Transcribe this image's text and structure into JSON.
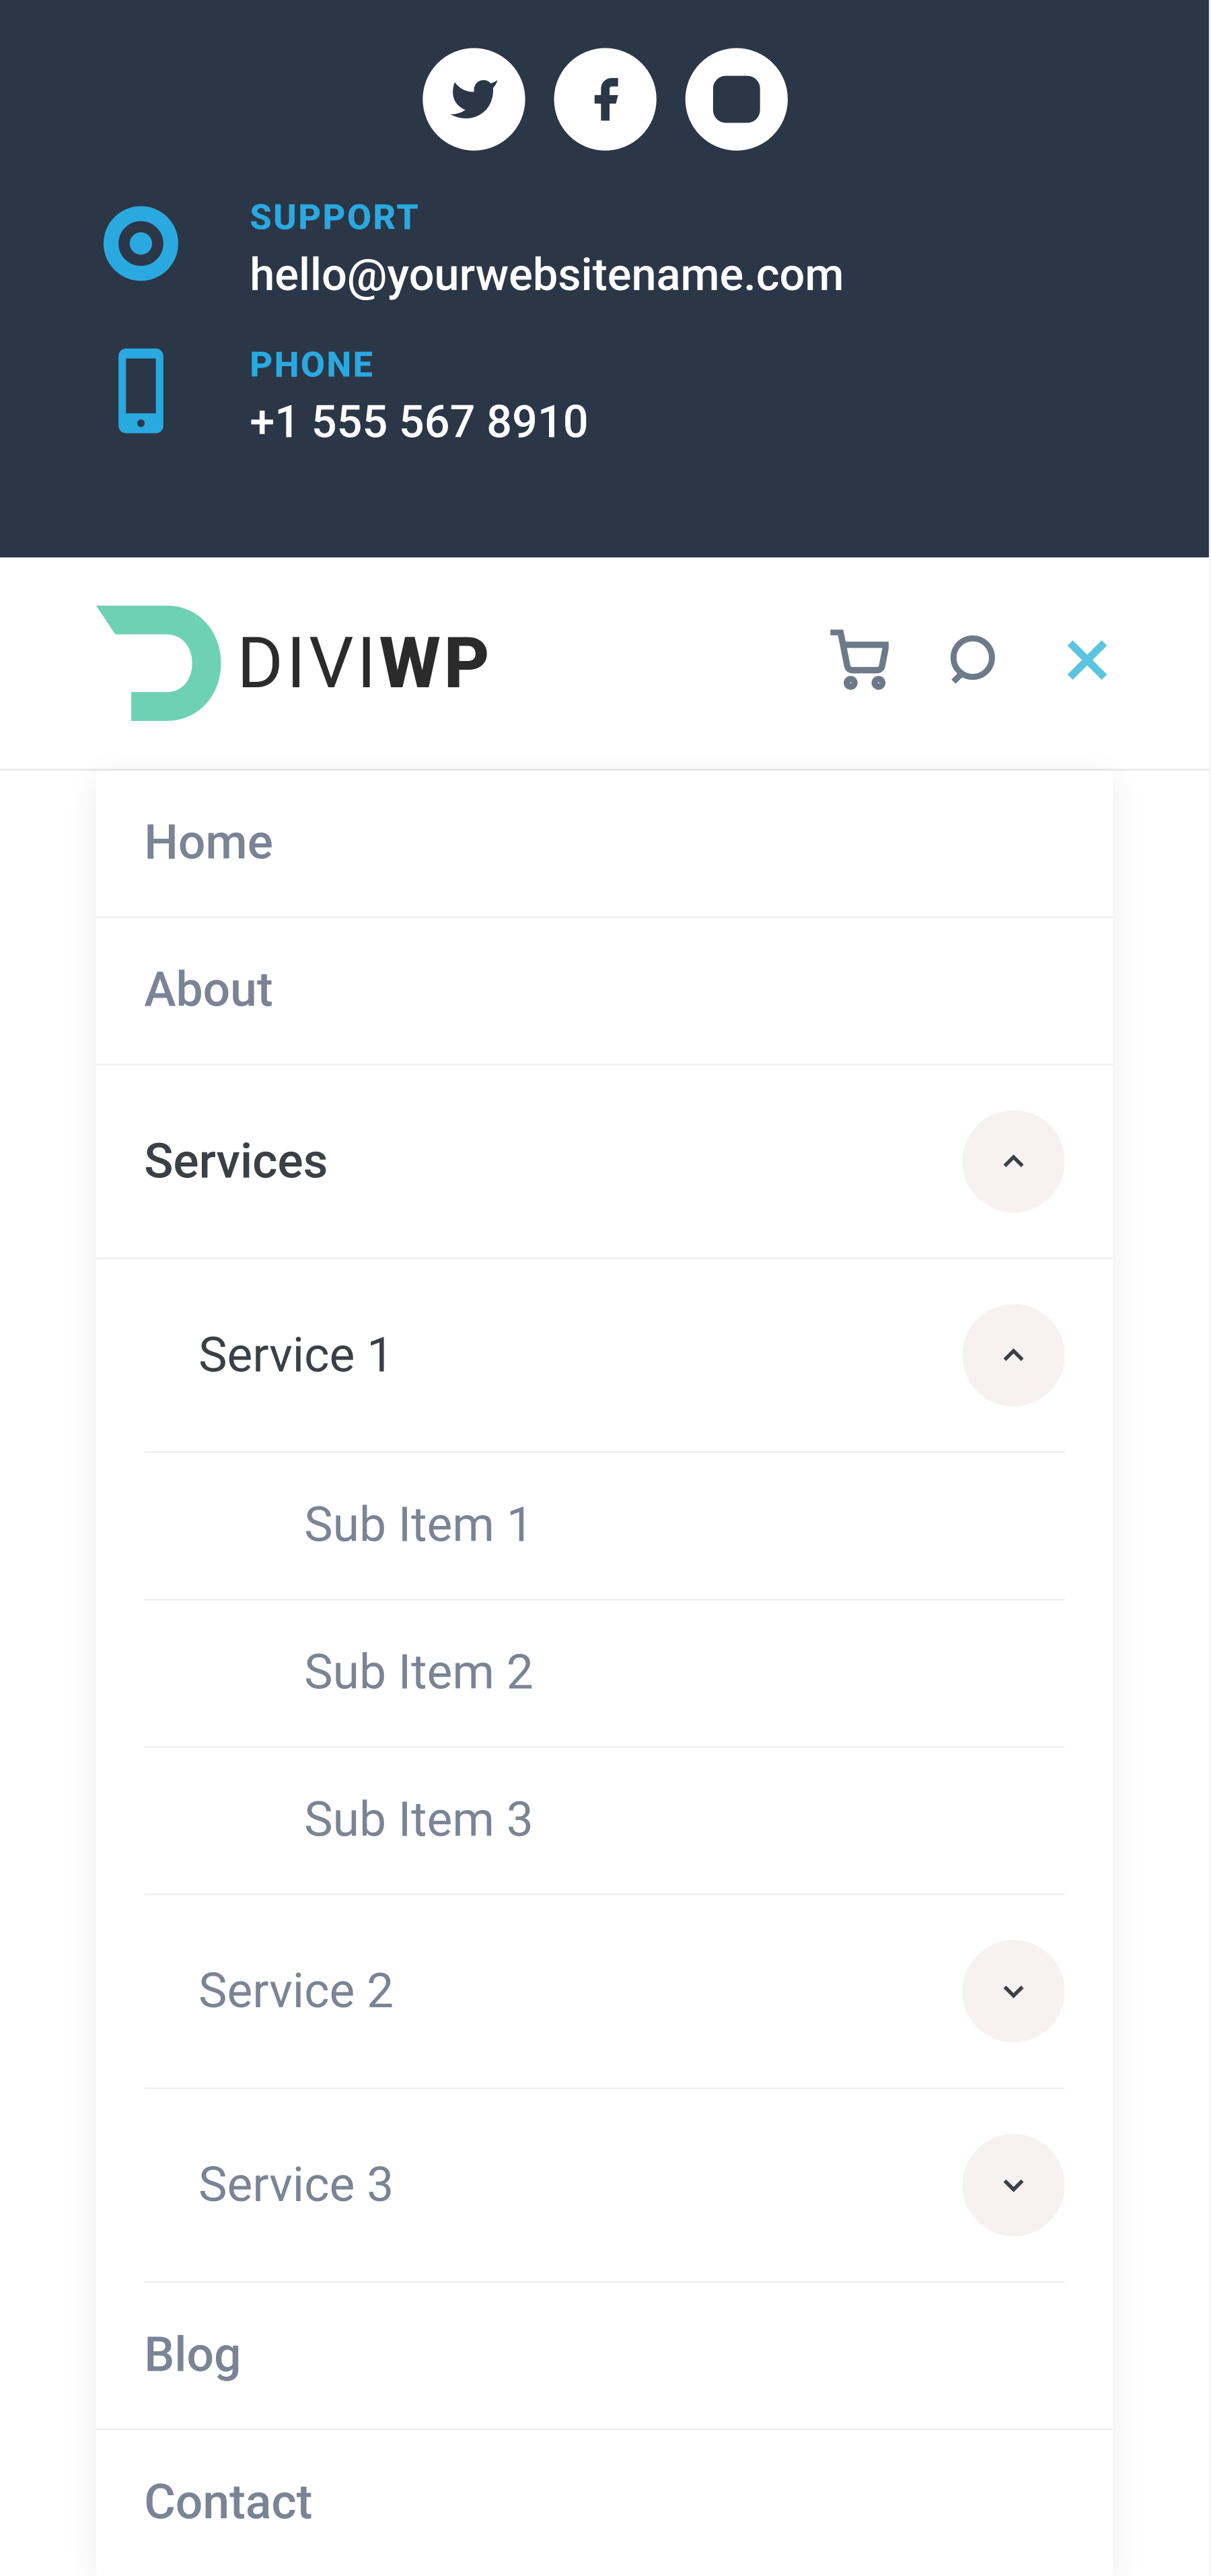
{
  "topbar": {
    "support": {
      "label": "SUPPORT",
      "value": "hello@yourwebsitename.com"
    },
    "phone": {
      "label": "PHONE",
      "value": "+1 555 567 8910"
    }
  },
  "logo": {
    "text1": "DIVI",
    "text2": "WP"
  },
  "menu": {
    "home": "Home",
    "about": "About",
    "services": "Services",
    "service1": "Service 1",
    "sub1": "Sub Item 1",
    "sub2": "Sub Item 2",
    "sub3": "Sub Item 3",
    "service2": "Service 2",
    "service3": "Service 3",
    "blog": "Blog",
    "contact": "Contact"
  },
  "colors": {
    "darkbg": "#2b3647",
    "accent_blue": "#2aa9e0",
    "mint": "#6fd1b3",
    "close_blue": "#5bc4de",
    "text_gray": "#7a8494",
    "text_dark": "#3b3f46"
  }
}
